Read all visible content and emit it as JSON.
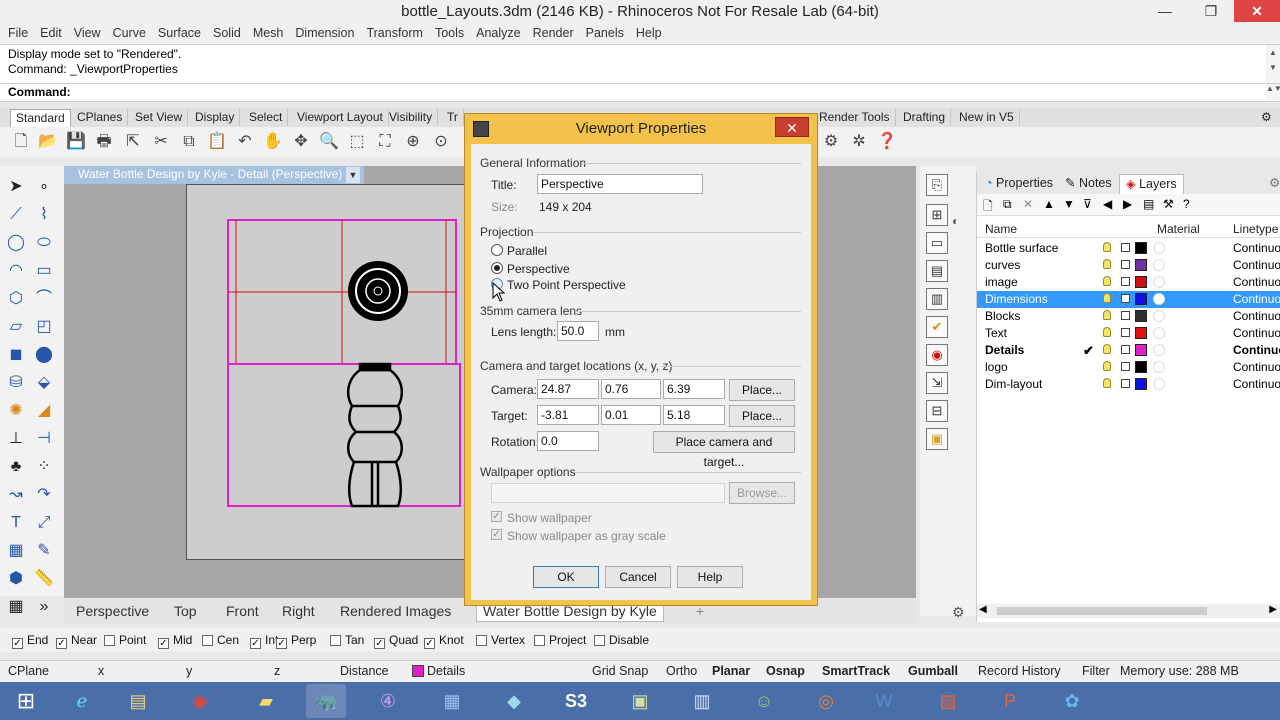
{
  "window": {
    "title": "bottle_Layouts.3dm (2146 KB) - Rhinoceros Not For Resale Lab (64-bit)",
    "min": "—",
    "max": "❐",
    "close": "✕"
  },
  "menu": [
    "File",
    "Edit",
    "View",
    "Curve",
    "Surface",
    "Solid",
    "Mesh",
    "Dimension",
    "Transform",
    "Tools",
    "Analyze",
    "Render",
    "Panels",
    "Help"
  ],
  "command_history": [
    "Display mode set to \"Rendered\".",
    "Command: _ViewportProperties"
  ],
  "command_prompt": "Command:",
  "toolbar_tabs": [
    "Standard",
    "CPlanes",
    "Set View",
    "Display",
    "Select",
    "Viewport Layout",
    "Visibility",
    "Tr",
    "Render Tools",
    "Drafting",
    "New in V5"
  ],
  "viewport": {
    "title": "Water Bottle Design by Kyle - Detail (Perspective)",
    "colors": {
      "detail_border": "#e020c8",
      "background": "#a6a6a6",
      "paper": "#cdcdcd"
    }
  },
  "view_tabs": [
    "Perspective",
    "Top",
    "Front",
    "Right",
    "Rendered Images",
    "Water Bottle Design by Kyle"
  ],
  "view_tab_add": "+",
  "osnaps": [
    {
      "label": "End",
      "checked": true
    },
    {
      "label": "Near",
      "checked": true
    },
    {
      "label": "Point",
      "checked": false
    },
    {
      "label": "Mid",
      "checked": true
    },
    {
      "label": "Cen",
      "checked": false
    },
    {
      "label": "Int",
      "checked": true
    },
    {
      "label": "Perp",
      "checked": true
    },
    {
      "label": "Tan",
      "checked": false
    },
    {
      "label": "Quad",
      "checked": true
    },
    {
      "label": "Knot",
      "checked": true
    },
    {
      "label": "Vertex",
      "checked": false
    },
    {
      "label": "Project",
      "checked": false
    },
    {
      "label": "Disable",
      "checked": false
    }
  ],
  "status": {
    "cplane": "CPlane",
    "x": "x",
    "y": "y",
    "z": "z",
    "distance": "Distance",
    "layer": "Details",
    "layer_color": "#e020c8",
    "grid_snap": "Grid Snap",
    "ortho": "Ortho",
    "planar": "Planar",
    "osnap": "Osnap",
    "smarttrack": "SmartTrack",
    "gumball": "Gumball",
    "record_history": "Record History",
    "filter": "Filter",
    "memory": "Memory use: 288 MB"
  },
  "panel": {
    "tabs": [
      "Properties",
      "Notes",
      "Layers"
    ],
    "columns": {
      "name": "Name",
      "material": "Material",
      "linetype": "Linetype"
    },
    "layers": [
      {
        "name": "Bottle surface",
        "color": "#000000",
        "linetype": "Continuou",
        "selected": false,
        "current": false
      },
      {
        "name": "curves",
        "color": "#7030a0",
        "linetype": "Continuou",
        "selected": false,
        "current": false
      },
      {
        "name": "image",
        "color": "#d01010",
        "linetype": "Continuou",
        "selected": false,
        "current": false
      },
      {
        "name": "Dimensions",
        "color": "#1010e0",
        "linetype": "Continuou",
        "selected": true,
        "current": false
      },
      {
        "name": "Blocks",
        "color": "#303030",
        "linetype": "Continuou",
        "selected": false,
        "current": false
      },
      {
        "name": "Text",
        "color": "#e01010",
        "linetype": "Continuou",
        "selected": false,
        "current": false
      },
      {
        "name": "Details",
        "color": "#e020c8",
        "linetype": "Continuou",
        "selected": false,
        "current": true
      },
      {
        "name": "logo",
        "color": "#000000",
        "linetype": "Continuou",
        "selected": false,
        "current": false
      },
      {
        "name": "Dim-layout",
        "color": "#1010e0",
        "linetype": "Continuou",
        "selected": false,
        "current": false
      }
    ]
  },
  "dialog": {
    "title": "Viewport Properties",
    "general_label": "General Information",
    "title_label": "Title:",
    "title_value": "Perspective",
    "size_label": "Size:",
    "size_value": "149 x 204",
    "projection_label": "Projection",
    "projection_options": [
      "Parallel",
      "Perspective",
      "Two Point Perspective"
    ],
    "projection_selected": "Perspective",
    "camera_lens_label": "35mm camera lens",
    "lens_length_label": "Lens length:",
    "lens_length_value": "50.0",
    "lens_unit": "mm",
    "locations_label": "Camera and target locations (x, y, z)",
    "camera_label": "Camera:",
    "camera": [
      "24.87",
      "0.76",
      "6.39"
    ],
    "target_label": "Target:",
    "target": [
      "-3.81",
      "0.01",
      "5.18"
    ],
    "rotation_label": "Rotation:",
    "rotation_value": "0.0",
    "place_label": "Place...",
    "place_camera_target_label": "Place camera and target...",
    "wallpaper_label": "Wallpaper options",
    "browse_label": "Browse...",
    "show_wallpaper_label": "Show wallpaper",
    "show_wallpaper_gray_label": "Show wallpaper as gray scale",
    "ok_label": "OK",
    "cancel_label": "Cancel",
    "help_label": "Help"
  }
}
